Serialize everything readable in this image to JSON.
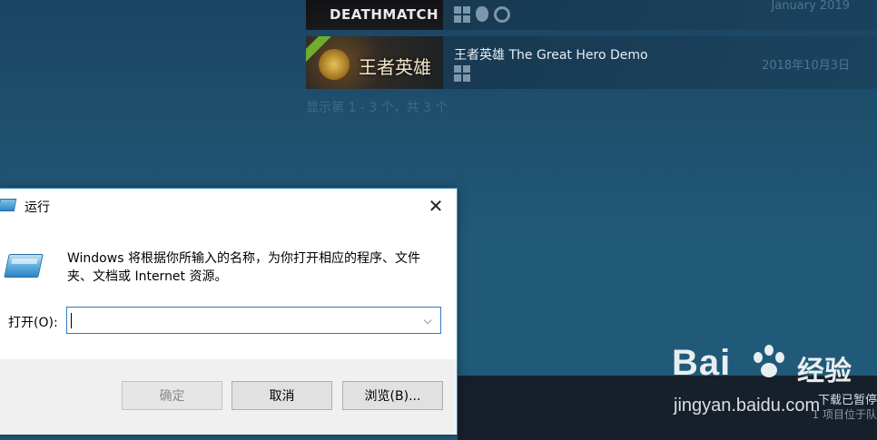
{
  "steam": {
    "games": [
      {
        "capsule_text": "DEATHMATCH",
        "name": "",
        "date": "January 2019",
        "platforms": [
          "windows-icon",
          "apple-icon",
          "steam-icon"
        ]
      },
      {
        "capsule_text": "王者英雄",
        "name": "王者英雄 The Great Hero Demo",
        "date": "2018年10月3日",
        "platforms": [
          "windows-icon"
        ]
      }
    ],
    "count_text": "显示第 1 - 3 个，共 3 个"
  },
  "bottom_bar": {
    "status": "下载已暂停",
    "sub": "1 项目位于队"
  },
  "watermark": {
    "brand": "Bai",
    "brand_cn": "经验",
    "url": "jingyan.baidu.com"
  },
  "run_dialog": {
    "title": "运行",
    "close_symbol": "✕",
    "description": "Windows 将根据你所输入的名称，为你打开相应的程序、文件夹、文档或 Internet 资源。",
    "open_label": "打开(O):",
    "open_value": "",
    "combo_arrow": "⌵",
    "buttons": {
      "ok": "确定",
      "cancel": "取消",
      "browse": "浏览(B)..."
    }
  }
}
